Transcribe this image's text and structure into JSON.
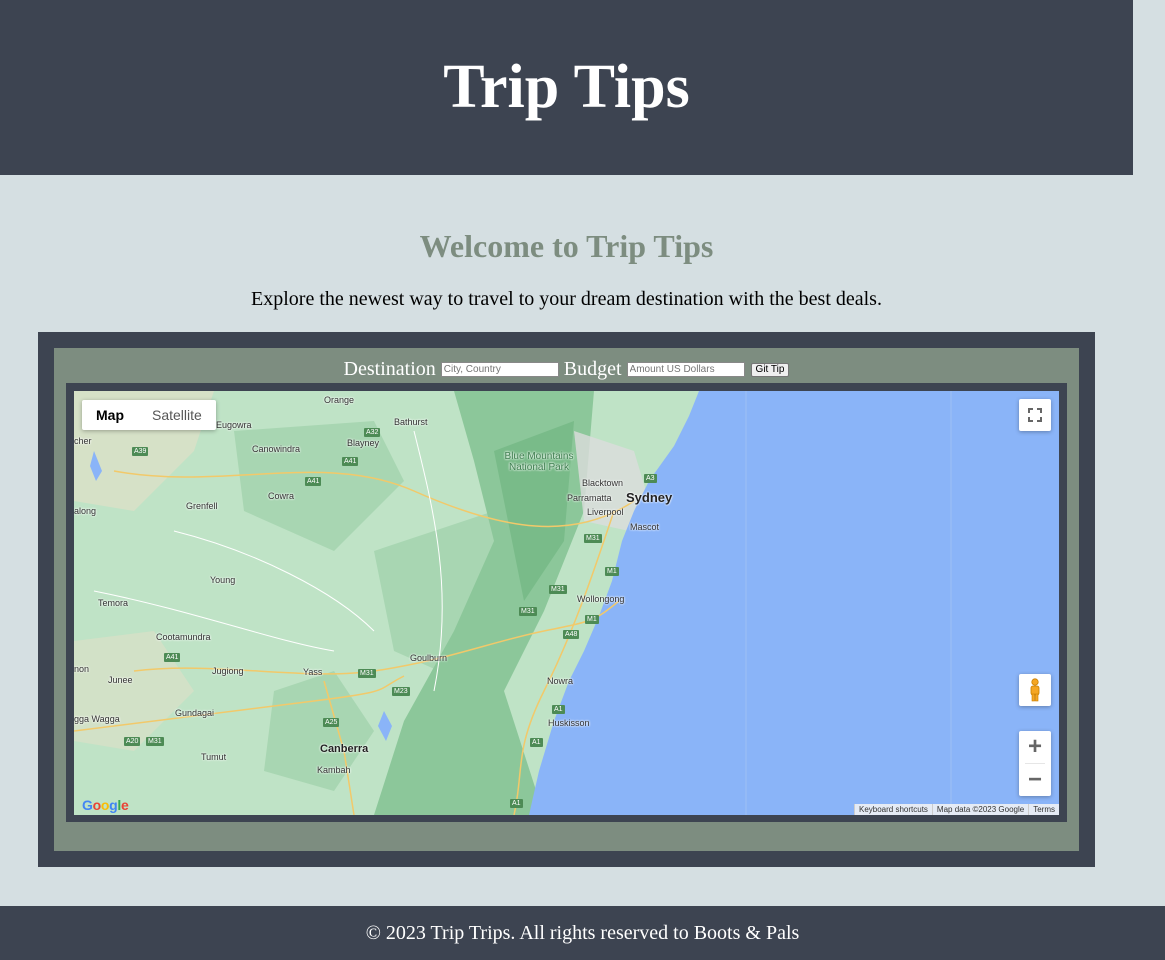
{
  "header": {
    "title": "Trip Tips"
  },
  "main": {
    "welcome": "Welcome to Trip Tips",
    "intro": "Explore the newest way to travel to your dream destination with the best deals."
  },
  "form": {
    "destination_label": "Destination",
    "destination_placeholder": "City, Country",
    "budget_label": "Budget",
    "budget_placeholder": "Amount US Dollars",
    "submit_label": "Git Tip"
  },
  "map": {
    "type_map": "Map",
    "type_satellite": "Satellite",
    "logo": "Google",
    "attribution": {
      "shortcuts": "Keyboard shortcuts",
      "data": "Map data ©2023 Google",
      "terms": "Terms"
    },
    "cities": {
      "orange": "Orange",
      "bathurst": "Bathurst",
      "eugowra": "Eugowra",
      "blayney": "Blayney",
      "canowindra": "Canowindra",
      "cowra": "Cowra",
      "grenfell": "Grenfell",
      "young": "Young",
      "temora": "Temora",
      "cootamundra": "Cootamundra",
      "junee": "Junee",
      "jugiong": "Jugiong",
      "yass": "Yass",
      "goulburn": "Goulburn",
      "wagga": "gga Wagga",
      "gundagai": "Gundagai",
      "tumut": "Tumut",
      "canberra": "Canberra",
      "kambah": "Kambah",
      "blacktown": "Blacktown",
      "parramatta": "Parramatta",
      "sydney": "Sydney",
      "liverpool": "Liverpool",
      "mascot": "Mascot",
      "wollongong": "Wollongong",
      "nowra": "Nowra",
      "huskisson": "Huskisson",
      "bluemtn": "Blue Mountains National Park",
      "parkes": "cher",
      "forbes": "along",
      "mon": "non"
    },
    "roads": {
      "a32": "A32",
      "a39": "A39",
      "a41a": "A41",
      "a41b": "A41",
      "a41c": "A41",
      "a3": "A3",
      "m31a": "M31",
      "m31b": "M31",
      "m31c": "M31",
      "m31d": "M31",
      "m1a": "M1",
      "m1b": "M1",
      "a48": "A48",
      "a1a": "A1",
      "a1b": "A1",
      "a1c": "A1",
      "m23": "M23",
      "a25": "A25",
      "a20": "A20",
      "m31e": "M31"
    }
  },
  "footer": {
    "text": "© 2023 Trip Trips. All rights reserved to Boots & Pals"
  },
  "colors": {
    "dark": "#3d4451",
    "sage": "#7d8d80",
    "page_bg": "#d5dfe2",
    "ocean": "#8ab4f8",
    "land": "#b7dfc0"
  }
}
